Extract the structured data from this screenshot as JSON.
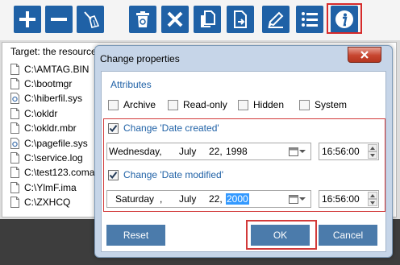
{
  "toolbar": {
    "buttons": [
      {
        "name": "add-button",
        "icon": "plus-icon"
      },
      {
        "name": "remove-button",
        "icon": "minus-icon"
      },
      {
        "name": "clear-button",
        "icon": "broom-icon"
      },
      {
        "name": "delete-button",
        "icon": "recycle-bin-icon"
      },
      {
        "name": "cancel-button",
        "icon": "x-icon"
      },
      {
        "name": "copy-button",
        "icon": "copy-files-icon"
      },
      {
        "name": "move-button",
        "icon": "file-arrow-icon"
      },
      {
        "name": "rename-button",
        "icon": "pencil-icon"
      },
      {
        "name": "list-button",
        "icon": "list-icon"
      },
      {
        "name": "properties-button",
        "icon": "info-icon"
      }
    ],
    "accent": "#1f61a6",
    "highlight": "#d62a2a"
  },
  "list": {
    "target_label": "Target: the resource",
    "files": [
      {
        "name": "C:\\AMTAG.BIN",
        "icon": "file-icon"
      },
      {
        "name": "C:\\bootmgr",
        "icon": "file-icon"
      },
      {
        "name": "C:\\hiberfil.sys",
        "icon": "system-file-icon"
      },
      {
        "name": "C:\\okldr",
        "icon": "file-icon"
      },
      {
        "name": "C:\\okldr.mbr",
        "icon": "file-icon"
      },
      {
        "name": "C:\\pagefile.sys",
        "icon": "system-file-icon"
      },
      {
        "name": "C:\\service.log",
        "icon": "file-icon"
      },
      {
        "name": "C:\\test123.coma",
        "icon": "file-icon"
      },
      {
        "name": "C:\\YlmF.ima",
        "icon": "file-icon"
      },
      {
        "name": "C:\\ZXHCQ",
        "icon": "file-icon"
      }
    ]
  },
  "dialog": {
    "title": "Change properties",
    "attributes_title": "Attributes",
    "attributes": [
      {
        "label": "Archive",
        "checked": false
      },
      {
        "label": "Read-only",
        "checked": false
      },
      {
        "label": "Hidden",
        "checked": false
      },
      {
        "label": "System",
        "checked": false
      }
    ],
    "date_created": {
      "label": "Change 'Date created'",
      "checked": true,
      "weekday": "Wednesday,",
      "month": "July",
      "day": "22,",
      "year": "1998",
      "time": "16:56:00"
    },
    "date_modified": {
      "label": "Change 'Date modified'",
      "checked": true,
      "weekday": "Saturday",
      "comma": ",",
      "month": "July",
      "day": "22,",
      "year": "2000",
      "time": "16:56:00"
    },
    "buttons": {
      "reset": "Reset",
      "ok": "OK",
      "cancel": "Cancel"
    }
  }
}
